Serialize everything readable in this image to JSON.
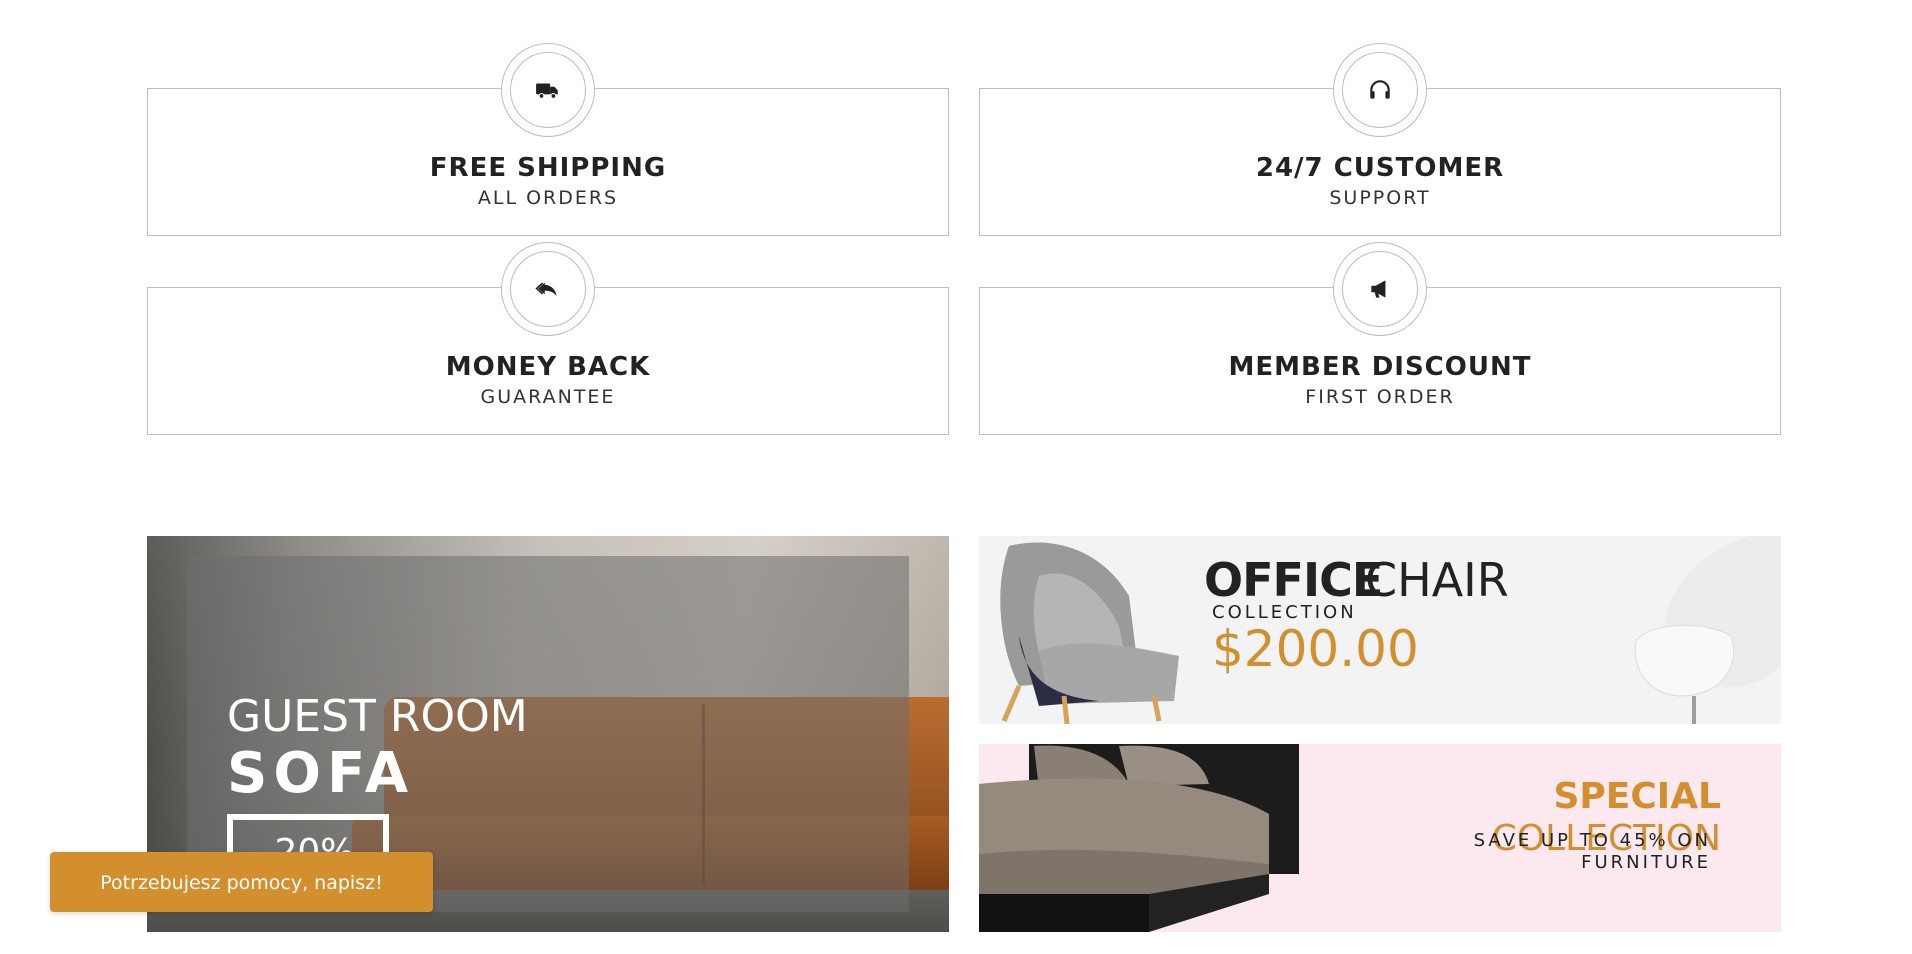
{
  "features": [
    {
      "icon": "truck-icon",
      "title": "FREE SHIPPING",
      "subtitle": "ALL ORDERS"
    },
    {
      "icon": "headphones-icon",
      "title": "24/7 CUSTOMER",
      "subtitle": "SUPPORT"
    },
    {
      "icon": "reply-all-icon",
      "title": "MONEY BACK",
      "subtitle": "GUARANTEE"
    },
    {
      "icon": "megaphone-icon",
      "title": "MEMBER DISCOUNT",
      "subtitle": "FIRST ORDER"
    }
  ],
  "banners": {
    "sofa": {
      "line1": "GUEST ROOM",
      "line2": "SOFA",
      "discount": "-20%"
    },
    "office_chair": {
      "title_bold": "OFFICE",
      "title_light": "CHAIR",
      "subtitle": "COLLECTION",
      "price": "$200.00"
    },
    "special": {
      "title_bold": "SPECIAL",
      "title_light": "COLLECTION",
      "subtitle": "SAVE UP TO 45% ON FURNITURE"
    }
  },
  "help_button": {
    "label": "Potrzebujesz pomocy, napisz!"
  },
  "colors": {
    "accent": "#d38f2d",
    "border": "#bdbdbd",
    "text_dark": "#222222",
    "chair_banner_bg": "#f2f3f5",
    "special_banner_bg": "#fce8ef"
  }
}
